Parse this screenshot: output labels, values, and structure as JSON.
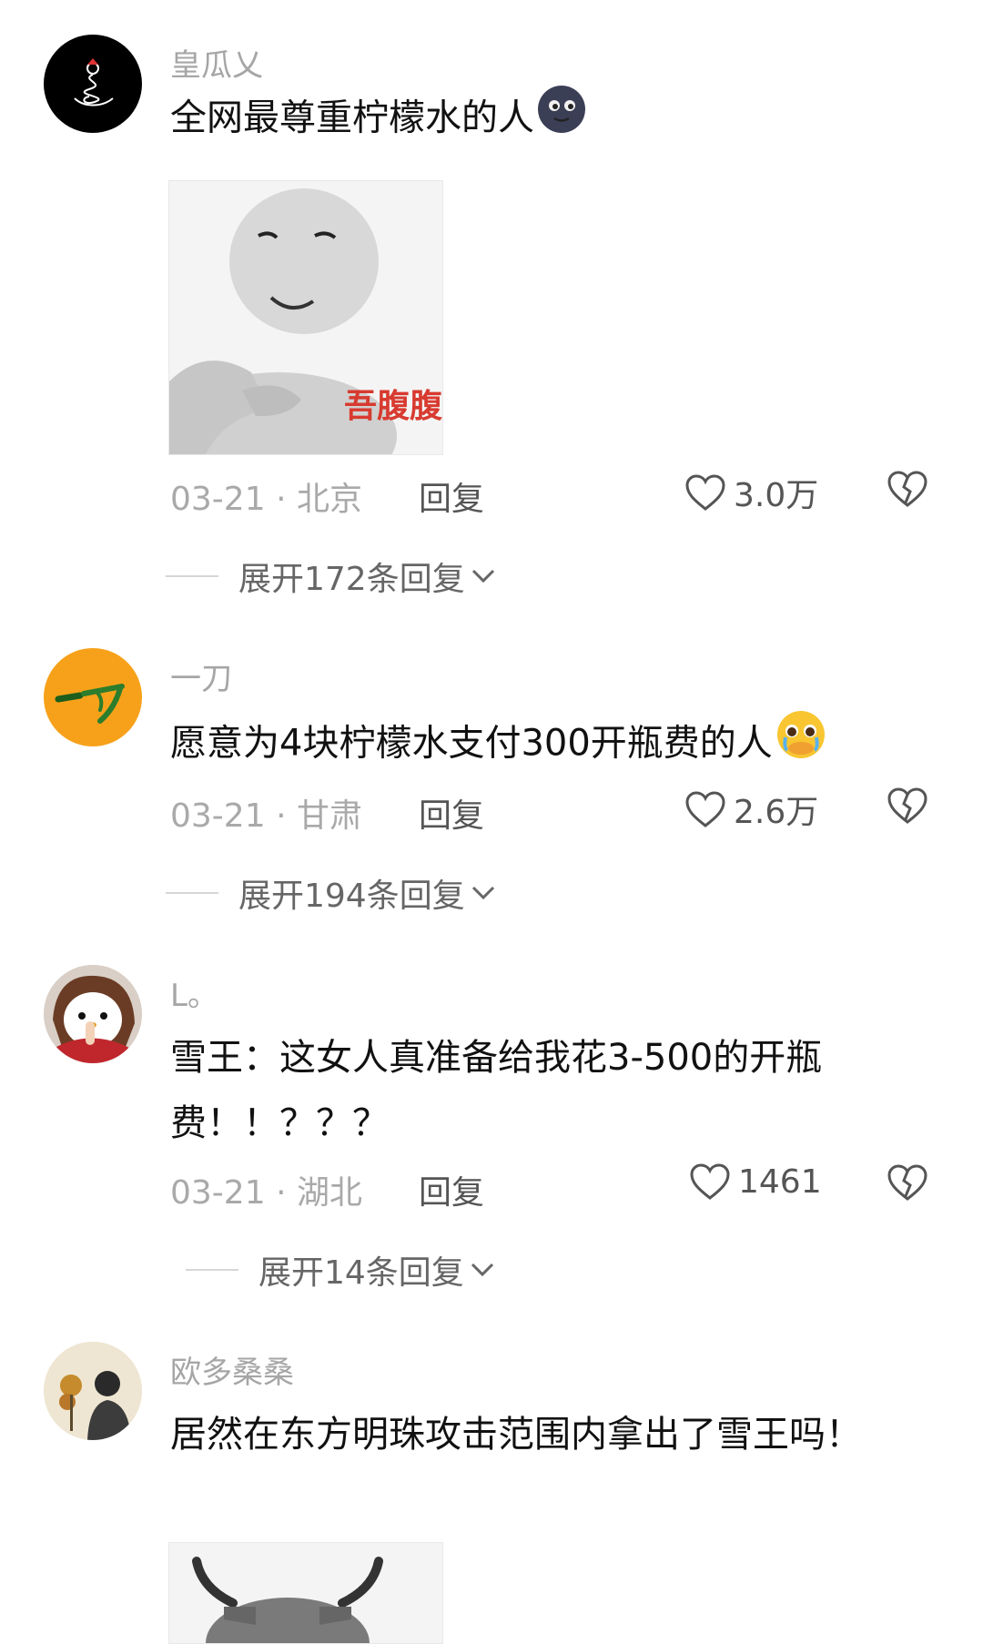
{
  "comments": [
    {
      "username": "皇瓜乂",
      "text": "全网最尊重柠檬水的人",
      "emoji": "new-moon-face-emoji",
      "sticker_caption": "吾腹腹",
      "date": "03-21",
      "location": "北京",
      "reply_label": "回复",
      "likes": "3.0万",
      "expand_label": "展开172条回复"
    },
    {
      "username": "一刀",
      "text": "愿意为4块柠檬水支付300开瓶费的人",
      "emoji": "pleading-face-emoji",
      "date": "03-21",
      "location": "甘肃",
      "reply_label": "回复",
      "likes": "2.6万",
      "expand_label": "展开194条回复"
    },
    {
      "username": "L。",
      "text": "雪王：这女人真准备给我花3-500的开瓶费！！？？？",
      "date": "03-21",
      "location": "湖北",
      "reply_label": "回复",
      "likes": "1461",
      "expand_label": "展开14条回复"
    },
    {
      "username": "欧多桑桑",
      "text": "居然在东方明珠攻击范围内拿出了雪王吗！"
    }
  ],
  "colors": {
    "username": "#a6a6a6",
    "meta": "#a9a9a9",
    "avatar2_bg": "#f7a11a"
  }
}
